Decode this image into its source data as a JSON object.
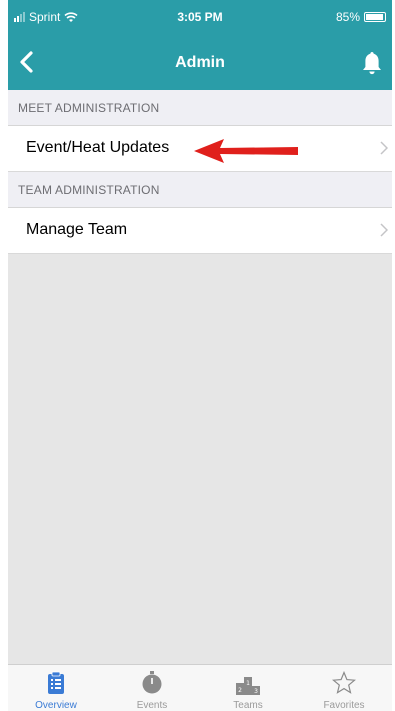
{
  "status_bar": {
    "carrier": "Sprint",
    "time": "3:05 PM",
    "battery": "85%"
  },
  "nav": {
    "title": "Admin",
    "back_icon": "chevron-left-icon",
    "bell_icon": "bell-icon"
  },
  "sections": [
    {
      "header": "MEET ADMINISTRATION",
      "rows": [
        {
          "label": "Event/Heat Updates"
        }
      ]
    },
    {
      "header": "TEAM ADMINISTRATION",
      "rows": [
        {
          "label": "Manage Team"
        }
      ]
    }
  ],
  "tabs": [
    {
      "label": "Overview",
      "icon": "clipboard-icon",
      "active": true
    },
    {
      "label": "Events",
      "icon": "stopwatch-icon",
      "active": false
    },
    {
      "label": "Teams",
      "icon": "podium-icon",
      "active": false
    },
    {
      "label": "Favorites",
      "icon": "star-icon",
      "active": false
    }
  ],
  "colors": {
    "header_bg": "#2a9da8",
    "arrow": "#e0201c",
    "active_tab": "#3a7bd5"
  }
}
